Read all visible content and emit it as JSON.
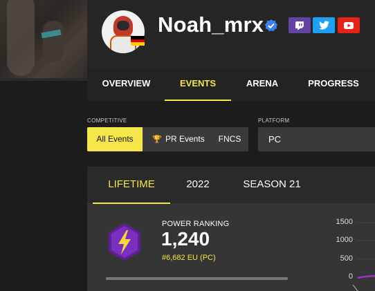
{
  "profile": {
    "username": "Noah_mrx",
    "verified_icon": "verified-check-icon",
    "country_flag": "germany-flag-icon",
    "social": [
      {
        "name": "twitch",
        "icon": "twitch-icon",
        "color": "#6441a5"
      },
      {
        "name": "twitter",
        "icon": "twitter-icon",
        "color": "#1da1f2"
      },
      {
        "name": "youtube",
        "icon": "youtube-icon",
        "color": "#e62117"
      }
    ]
  },
  "nav": {
    "tabs": [
      {
        "label": "OVERVIEW",
        "active": false
      },
      {
        "label": "EVENTS",
        "active": true
      },
      {
        "label": "ARENA",
        "active": false
      },
      {
        "label": "PROGRESS",
        "active": false
      }
    ]
  },
  "filters": {
    "competitive_label": "COMPETITIVE",
    "competitive_options": [
      {
        "label": "All Events",
        "active": true
      },
      {
        "label": "PR Events",
        "active": false,
        "icon": "trophy-icon"
      },
      {
        "label": "FNCS",
        "active": false
      }
    ],
    "platform_label": "PLATFORM",
    "platform_value": "PC"
  },
  "stats": {
    "season_tabs": [
      {
        "label": "LIFETIME",
        "active": true
      },
      {
        "label": "2022",
        "active": false
      },
      {
        "label": "SEASON 21",
        "active": false
      }
    ],
    "power_ranking": {
      "title": "POWER RANKING",
      "value": "1,240",
      "rank": "#6,682 EU (PC)",
      "badge_icon": "lightning-bolt-icon"
    }
  },
  "colors": {
    "accent": "#f5e649",
    "badge": "#7b2fbe",
    "chart_line": "#9b30c8"
  },
  "chart_data": {
    "type": "line",
    "y_ticks": [
      "1500",
      "1000",
      "500",
      "0"
    ],
    "ylim": [
      0,
      1500
    ]
  }
}
